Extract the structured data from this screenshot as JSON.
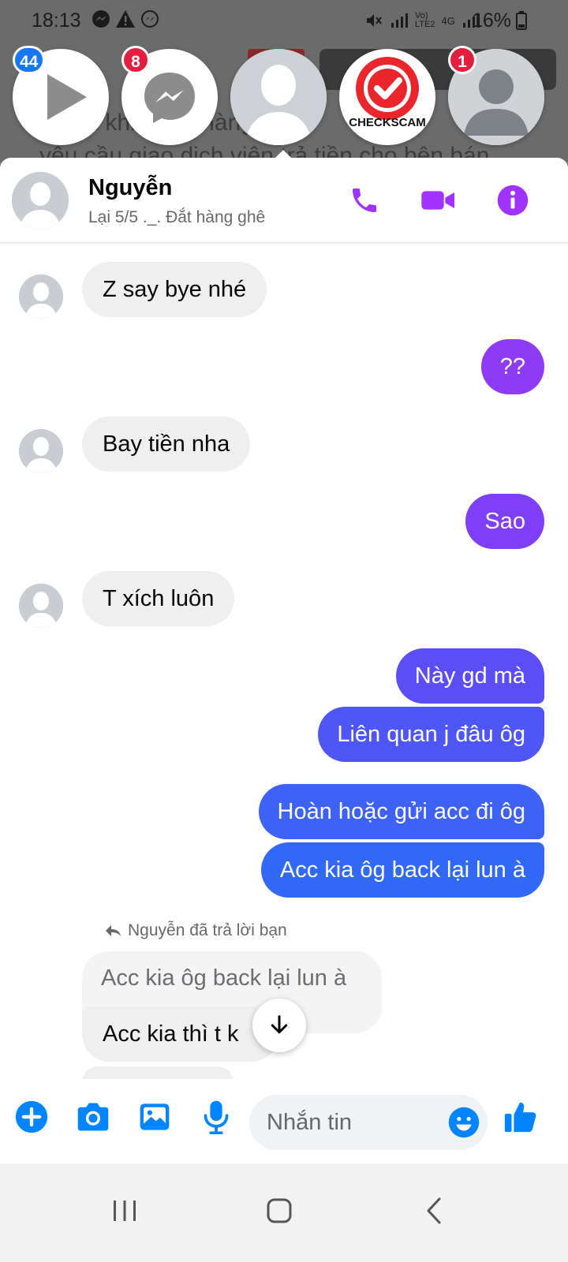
{
  "status_bar": {
    "time": "18:13",
    "battery": "16%",
    "network_label_1": "Vo)",
    "network_label_2": "LTE2",
    "network_gen": "4G"
  },
  "background": {
    "line_1": "ì toàn khi nhận hàng",
    "line_2": "yêu cầu giao dịch viên trả tiền cho bên bán"
  },
  "chat_heads": [
    {
      "name": "video-app",
      "badge": "44",
      "badge_color": "#1877f2"
    },
    {
      "name": "messenger",
      "badge": "8",
      "badge_color": "#e41e3f"
    },
    {
      "name": "contact-active",
      "badge": "",
      "badge_color": ""
    },
    {
      "name": "checkscam",
      "badge": "",
      "badge_color": "",
      "logo_text": "CHECKSCAM"
    },
    {
      "name": "contact-default",
      "badge": "1",
      "badge_color": "#e41e3f"
    }
  ],
  "header": {
    "name": "Nguyễn",
    "subtitle": "Lại 5/5 ._. Đắt hàng ghê",
    "icons": [
      "phone-icon",
      "video-camera-icon",
      "info-icon"
    ],
    "accent": "#a033ff"
  },
  "messages": [
    {
      "side": "in",
      "text": "Z say bye nhé"
    },
    {
      "side": "out",
      "text": "??",
      "color": "#8f3bf6"
    },
    {
      "side": "in",
      "text": "Bay tiền nha"
    },
    {
      "side": "out",
      "text": "Sao",
      "color": "#7f3ef8"
    },
    {
      "side": "in",
      "text": "T xích luôn"
    },
    {
      "side": "out",
      "text": "Này gd mà",
      "color": "#5b4ef7"
    },
    {
      "side": "out",
      "text": "Liên quan j đâu ôg",
      "color": "#4f56f6"
    },
    {
      "side": "out",
      "text": "Hoàn hoặc gửi acc đi ôg",
      "color": "#3d62f5"
    },
    {
      "side": "out",
      "text": "Acc kia ôg back lại lun à",
      "color": "#3168f5"
    }
  ],
  "reply": {
    "note": "Nguyễn đã trả lời bạn",
    "quoted": "Acc kia ôg back lại lun à",
    "text": "Acc kia thì t k"
  },
  "composer": {
    "placeholder": "Nhắn tin",
    "icons": [
      "plus-icon",
      "camera-icon",
      "gallery-icon",
      "microphone-icon",
      "emoji-icon",
      "thumbs-up-icon"
    ],
    "icon_color": "#0084ff"
  },
  "nav_bar": {
    "buttons": [
      "recents",
      "home",
      "back"
    ]
  }
}
